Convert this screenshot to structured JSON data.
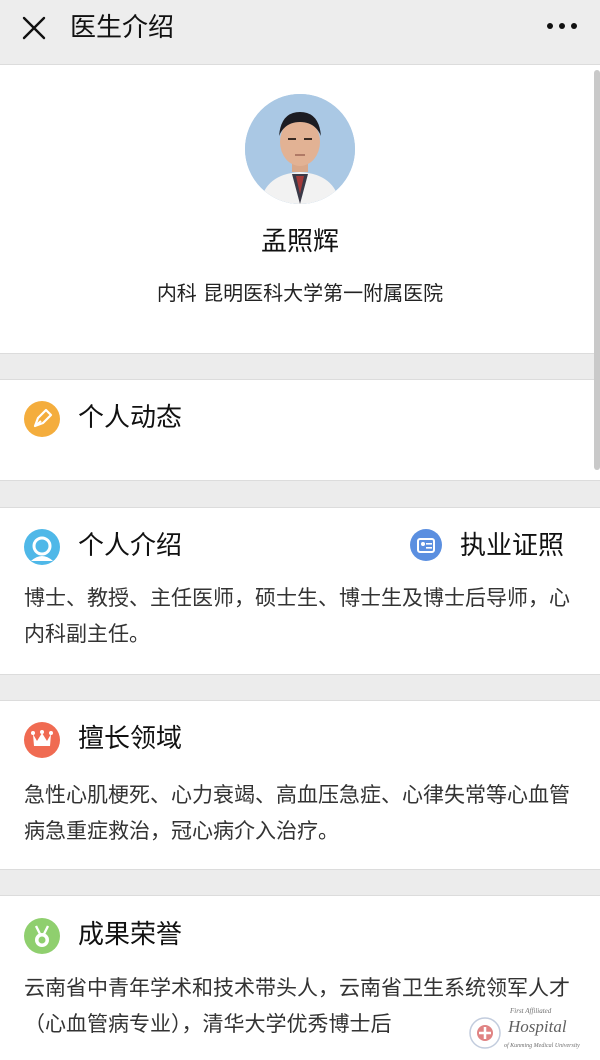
{
  "header": {
    "title": "医生介绍",
    "close_icon": "close-icon",
    "more_icon": "more-dots-icon"
  },
  "doctor": {
    "name": "孟照辉",
    "department": "内科 昆明医科大学第一附属医院"
  },
  "sections": {
    "dynamic": {
      "title": "个人动态",
      "icon": "pen-icon",
      "icon_color": "#f4ad3d"
    },
    "intro": {
      "title": "个人介绍",
      "icon": "person-icon",
      "icon_color": "#4fb8e8",
      "license_label": "执业证照",
      "license_icon": "id-card-icon",
      "license_icon_color": "#5b8fe0",
      "text": "博士、教授、主任医师，硕士生、博士生及博士后导师，心内科副主任。"
    },
    "expertise": {
      "title": "擅长领域",
      "icon": "crown-icon",
      "icon_color": "#f06b52",
      "text": "急性心肌梗死、心力衰竭、高血压急症、心律失常等心血管病急重症救治，冠心病介入治疗。"
    },
    "honors": {
      "title": "成果荣誉",
      "icon": "medal-icon",
      "icon_color": "#8fcf6e",
      "text": "云南省中青年学术和技术带头人，云南省卫生系统领军人才（心血管病专业），清华大学优秀博士后"
    }
  },
  "watermark": {
    "line1": "First Affiliated",
    "line2": "Hospital",
    "line3": "of Kunming Medical University"
  }
}
